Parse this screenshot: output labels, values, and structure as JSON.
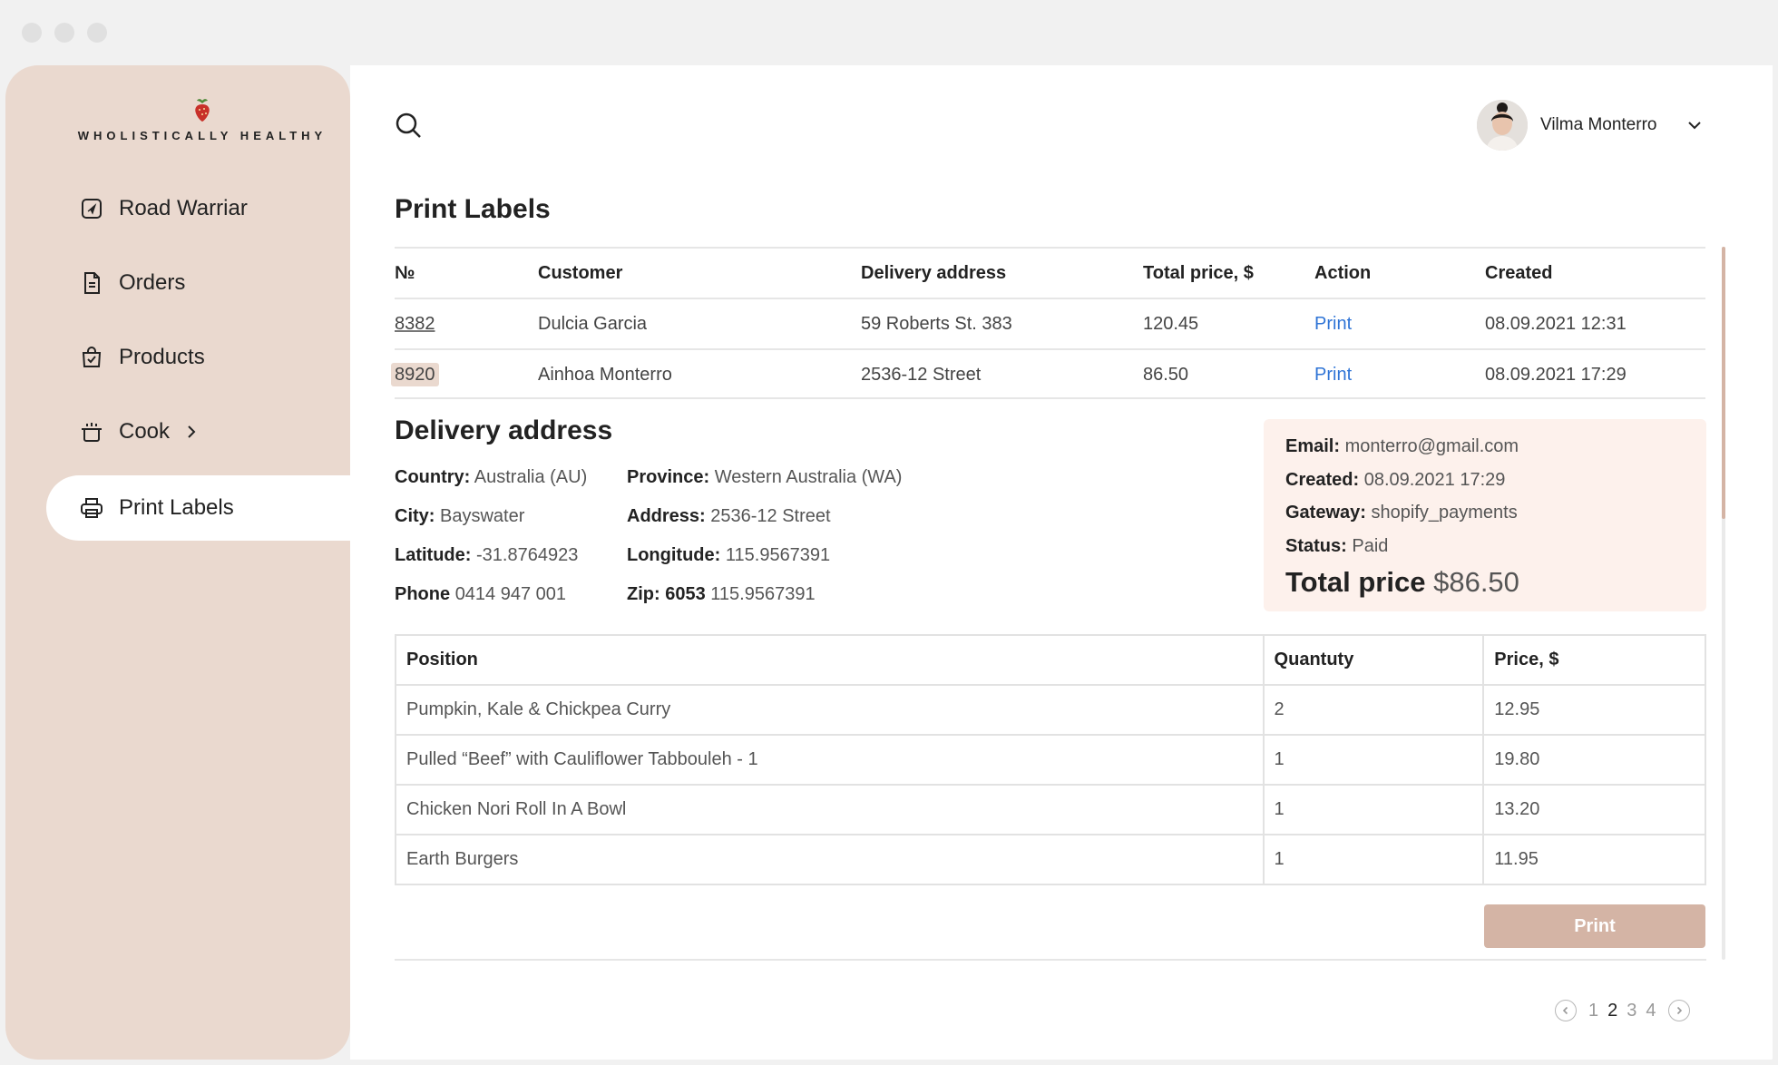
{
  "brand": {
    "name": "WHOLISTICALLY HEALTHY"
  },
  "sidebar": {
    "items": [
      {
        "label": "Road Warriar",
        "icon": "navigation-icon"
      },
      {
        "label": "Orders",
        "icon": "document-icon"
      },
      {
        "label": "Products",
        "icon": "shopping-bag-icon"
      },
      {
        "label": "Cook",
        "icon": "pot-icon"
      },
      {
        "label": "Print Labels",
        "icon": "printer-icon"
      }
    ]
  },
  "header": {
    "user_name": "Vilma Monterro"
  },
  "page": {
    "title": "Print Labels"
  },
  "orders": {
    "headers": [
      "№",
      "Customer",
      "Delivery address",
      "Total price, $",
      "Action",
      "Created"
    ],
    "rows": [
      {
        "id": "8382",
        "customer": "Dulcia Garcia",
        "address": "59 Roberts St. 383",
        "total": "120.45",
        "action": "Print",
        "created": "08.09.2021 12:31"
      },
      {
        "id": "8920",
        "customer": "Ainhoa Monterro",
        "address": "2536-12 Street",
        "total": "86.50",
        "action": "Print",
        "created": "08.09.2021 17:29"
      }
    ]
  },
  "delivery": {
    "title": "Delivery address",
    "country_label": "Country:",
    "country": "Australia (AU)",
    "province_label": "Province:",
    "province": "Western Australia (WA)",
    "city_label": "City:",
    "city": "Bayswater",
    "address_label": "Address:",
    "address": "2536-12 Street",
    "latitude_label": "Latitude:",
    "latitude": "-31.8764923",
    "longitude_label": "Longitude:",
    "longitude": "115.9567391",
    "phone_label": "Phone",
    "phone": "0414 947 001",
    "zip_label": "Zip: 6053",
    "zip": "115.9567391"
  },
  "summary": {
    "email_label": "Email:",
    "email": "monterro@gmail.com",
    "created_label": "Created:",
    "created": "08.09.2021 17:29",
    "gateway_label": "Gateway:",
    "gateway": "shopify_payments",
    "status_label": "Status:",
    "status": "Paid",
    "total_label": "Total price",
    "total": "$86.50"
  },
  "items": {
    "headers": [
      "Position",
      "Quantuty",
      "Price, $"
    ],
    "rows": [
      {
        "position": "Pumpkin, Kale & Chickpea Curry",
        "qty": "2",
        "price": "12.95"
      },
      {
        "position": "Pulled “Beef” with Cauliflower Tabbouleh - 1",
        "qty": "1",
        "price": "19.80"
      },
      {
        "position": "Chicken Nori Roll In A Bowl",
        "qty": "1",
        "price": "13.20"
      },
      {
        "position": "Earth Burgers",
        "qty": "1",
        "price": "11.95"
      }
    ]
  },
  "print_button": "Print",
  "pagination": {
    "pages": [
      "1",
      "2",
      "3",
      "4"
    ],
    "current": "2"
  },
  "colors": {
    "sidebar_bg": "#ead9cf",
    "accent": "#d4b4a5",
    "link": "#2f74d6",
    "summary_bg": "#fdf1ec"
  }
}
